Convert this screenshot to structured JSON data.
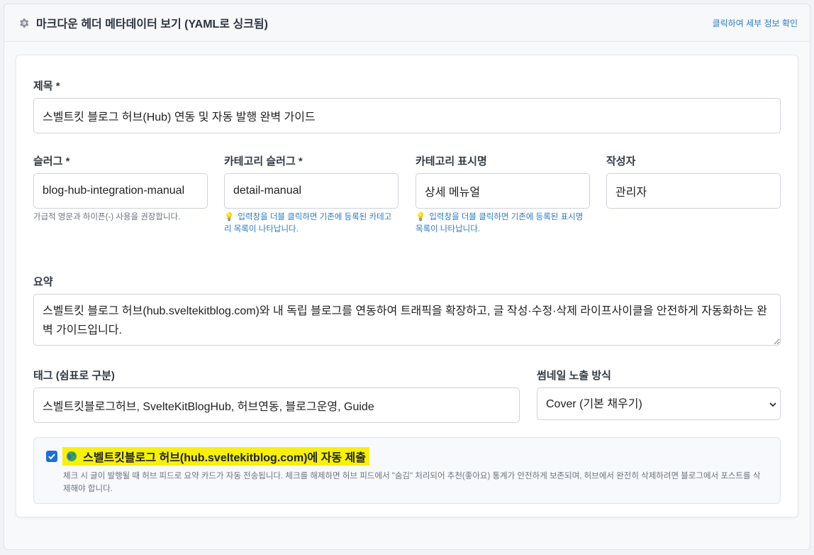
{
  "header": {
    "title": "마크다운 헤더 메타데이터 보기 (YAML로 싱크됨)",
    "details_link": "클릭하여 세부 정보 확인",
    "icon": "gear-icon"
  },
  "form": {
    "title": {
      "label": "제목 *",
      "value": "스벨트킷 블로그 허브(Hub) 연동 및 자동 발행 완벽 가이드"
    },
    "slug": {
      "label": "슬러그 *",
      "value": "blog-hub-integration-manual",
      "hint": "가급적 영문과 하이픈(-) 사용을 권장합니다."
    },
    "category_slug": {
      "label": "카테고리 슬러그 *",
      "value": "detail-manual",
      "hint": "입력창을 더블 클릭하면 기존에 등록된 카테고리 목록이 나타납니다."
    },
    "category_name": {
      "label": "카테고리 표시명",
      "value": "상세 메뉴얼",
      "hint": "입력창을 더블 클릭하면 기존에 등록된 표시명 목록이 나타납니다."
    },
    "author": {
      "label": "작성자",
      "value": "관리자"
    },
    "summary": {
      "label": "요약",
      "value": "스벨트킷 블로그 허브(hub.sveltekitblog.com)와 내 독립 블로그를 연동하여 트래픽을 확장하고, 글 작성·수정·삭제 라이프사이클을 안전하게 자동화하는 완벽 가이드입니다."
    },
    "tags": {
      "label": "태그 (쉼표로 구분)",
      "value": "스벨트킷블로그허브, SvelteKitBlogHub, 허브연동, 블로그운영, Guide"
    },
    "thumbnail": {
      "label": "썸네일 노출 방식",
      "selected": "Cover (기본 채우기)"
    },
    "hub": {
      "checked": true,
      "label": "스벨트킷블로그 허브(hub.sveltekitblog.com)에 자동 제출",
      "description": "체크 시 글이 발행될 때 허브 피드로 요약 카드가 자동 전송됩니다. 체크를 해제하면 허브 피드에서 \"숨김\" 처리되어 추천(좋아요) 통계가 안전하게 보존되며, 허브에서 완전히 삭제하려면 블로그에서 포스트를 삭제해야 합니다."
    }
  },
  "colors": {
    "accent": "#1e6fd9",
    "link": "#2b7bc4",
    "highlight": "#f6f00c"
  }
}
